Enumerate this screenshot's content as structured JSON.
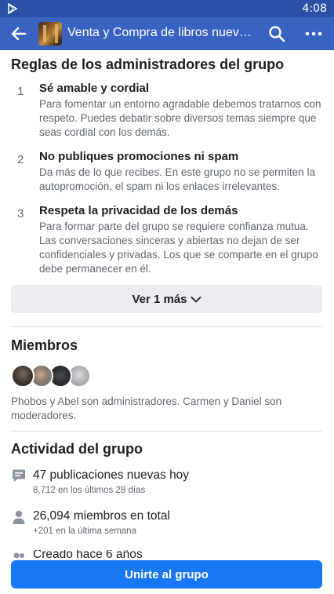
{
  "status_bar": {
    "time": "4:08",
    "icons": [
      "play-store-icon"
    ]
  },
  "app_bar": {
    "title": "Venta y Compra de libros nuevos y usados",
    "icons": [
      "back-arrow-icon",
      "search-icon",
      "more-options-icon"
    ]
  },
  "rules": {
    "title": "Reglas de los administradores del grupo",
    "items": [
      {
        "number": "1",
        "title": "Sé amable y cordial",
        "description": "Para fomentar un entorno agradable debemos tratarnos con respeto. Puedes debatir sobre diversos temas siempre que seas cordial con los demás."
      },
      {
        "number": "2",
        "title": "No publiques promociones ni spam",
        "description": "Da más de lo que recibes. En este grupo no se permiten la autopromoción, el spam ni los enlaces irrelevantes."
      },
      {
        "number": "3",
        "title": "Respeta la privacidad de los demás",
        "description": "Para formar parte del grupo se requiere confianza mutua. Las conversaciones sinceras y abiertas no dejan de ser confidenciales y privadas. Los que se comparte en el grupo debe permanecer en él."
      }
    ],
    "see_more_label": "Ver 1 más"
  },
  "members": {
    "title": "Miembros",
    "avatars": [
      "Phobos",
      "Abel",
      "Carmen",
      "Daniel"
    ],
    "description": "Phobos y Abel son administradores. Carmen y Daniel son moderadores."
  },
  "activity": {
    "title": "Actividad del grupo",
    "stats": [
      {
        "icon": "posts-icon",
        "main": "47 publicaciones nuevas hoy",
        "sub": "8,712 en los últimos 28 días"
      },
      {
        "icon": "person-icon",
        "main": "26,094 miembros en total",
        "sub": "+201 en la última semana"
      }
    ],
    "partial_next": "Creado hace 6 años"
  },
  "join_button_label": "Unirte al grupo",
  "colors": {
    "status_bar": "#2b51a6",
    "app_bar": "#3a62c1",
    "primary_button": "#1877f2",
    "secondary_button": "#ebedf0"
  }
}
